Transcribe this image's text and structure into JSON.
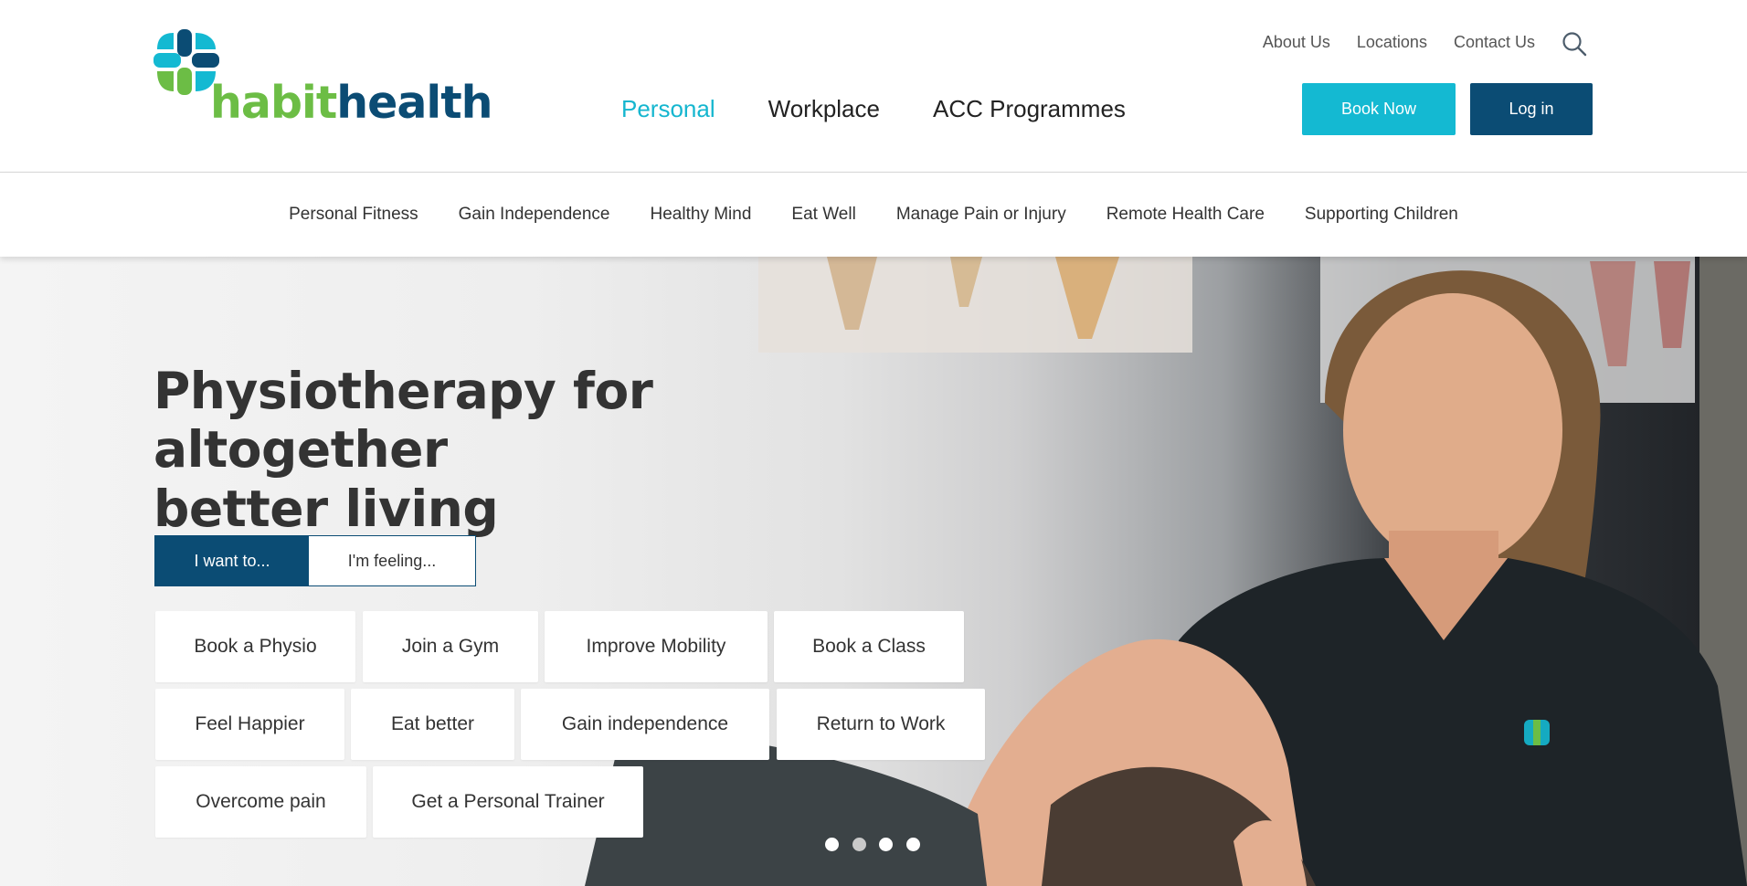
{
  "brand": {
    "word1": "habit",
    "word2": "health"
  },
  "colors": {
    "primary_navy": "#0b4c74",
    "accent_cyan": "#14b9d2",
    "brand_green": "#6cbd45"
  },
  "utility_nav": [
    {
      "label": "About Us"
    },
    {
      "label": "Locations"
    },
    {
      "label": "Contact Us"
    }
  ],
  "search": {
    "icon": "search-icon"
  },
  "main_nav": [
    {
      "label": "Personal",
      "active": true
    },
    {
      "label": "Workplace",
      "active": false
    },
    {
      "label": "ACC Programmes",
      "active": false
    }
  ],
  "header_buttons": {
    "book_now": "Book Now",
    "log_in": "Log in"
  },
  "sub_nav": [
    {
      "label": "Personal Fitness"
    },
    {
      "label": "Gain Independence"
    },
    {
      "label": "Healthy Mind"
    },
    {
      "label": "Eat Well"
    },
    {
      "label": "Manage Pain or Injury"
    },
    {
      "label": "Remote Health Care"
    },
    {
      "label": "Supporting Children"
    }
  ],
  "hero": {
    "title_line1": "Physiotherapy for altogether",
    "title_line2": "better living",
    "toggle": {
      "option1": "I want to...",
      "option2": "I'm feeling...",
      "selected": "I want to..."
    },
    "chips": [
      {
        "label": "Book a Physio"
      },
      {
        "label": "Join a Gym"
      },
      {
        "label": "Improve Mobility"
      },
      {
        "label": "Book a Class"
      },
      {
        "label": "Feel Happier"
      },
      {
        "label": "Eat better"
      },
      {
        "label": "Gain independence"
      },
      {
        "label": "Return to Work"
      },
      {
        "label": "Overcome pain"
      },
      {
        "label": "Get a Personal Trainer"
      }
    ],
    "carousel": {
      "total_slides": 4,
      "current_slide": 2
    }
  }
}
